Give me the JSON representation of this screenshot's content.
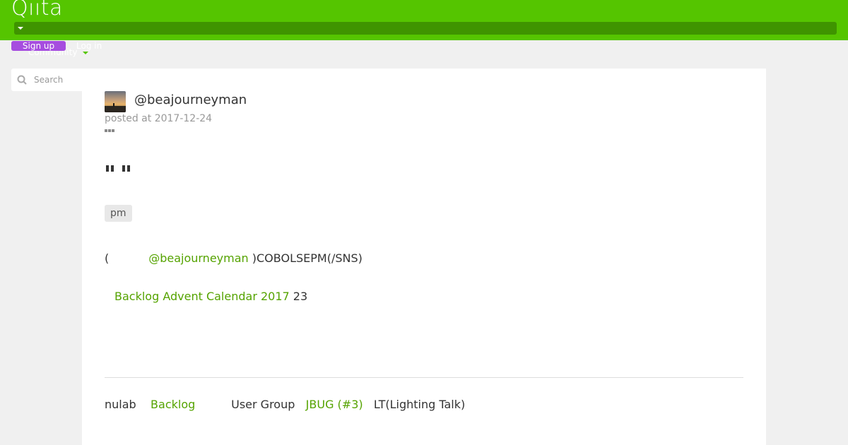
{
  "header": {
    "logo": "Qiita",
    "signup_label": "Sign up",
    "login_label": "Log in",
    "community_label": "Community"
  },
  "search": {
    "placeholder": "Search"
  },
  "article": {
    "author": "@beajourneyman",
    "posted": "posted at 2017-12-24",
    "tag": "pm",
    "p1": {
      "open": "(",
      "author_link": "@beajourneyman",
      "rest": ")COBOLSEPM(/SNS)"
    },
    "p2": {
      "calendar_link": "Backlog Advent Calendar 2017",
      "day": "23"
    },
    "footer": {
      "company": "nulab",
      "backlog_link": "Backlog",
      "user_group": "User Group",
      "jbug_link": "JBUG (#3)",
      "lt": "LT(Lighting Talk)"
    }
  },
  "colors": {
    "brand": "#55c500",
    "link": "#55a300",
    "signup": "#a64ddf"
  },
  "icons": [
    "search-icon",
    "caret-down-icon",
    "more-icon"
  ]
}
